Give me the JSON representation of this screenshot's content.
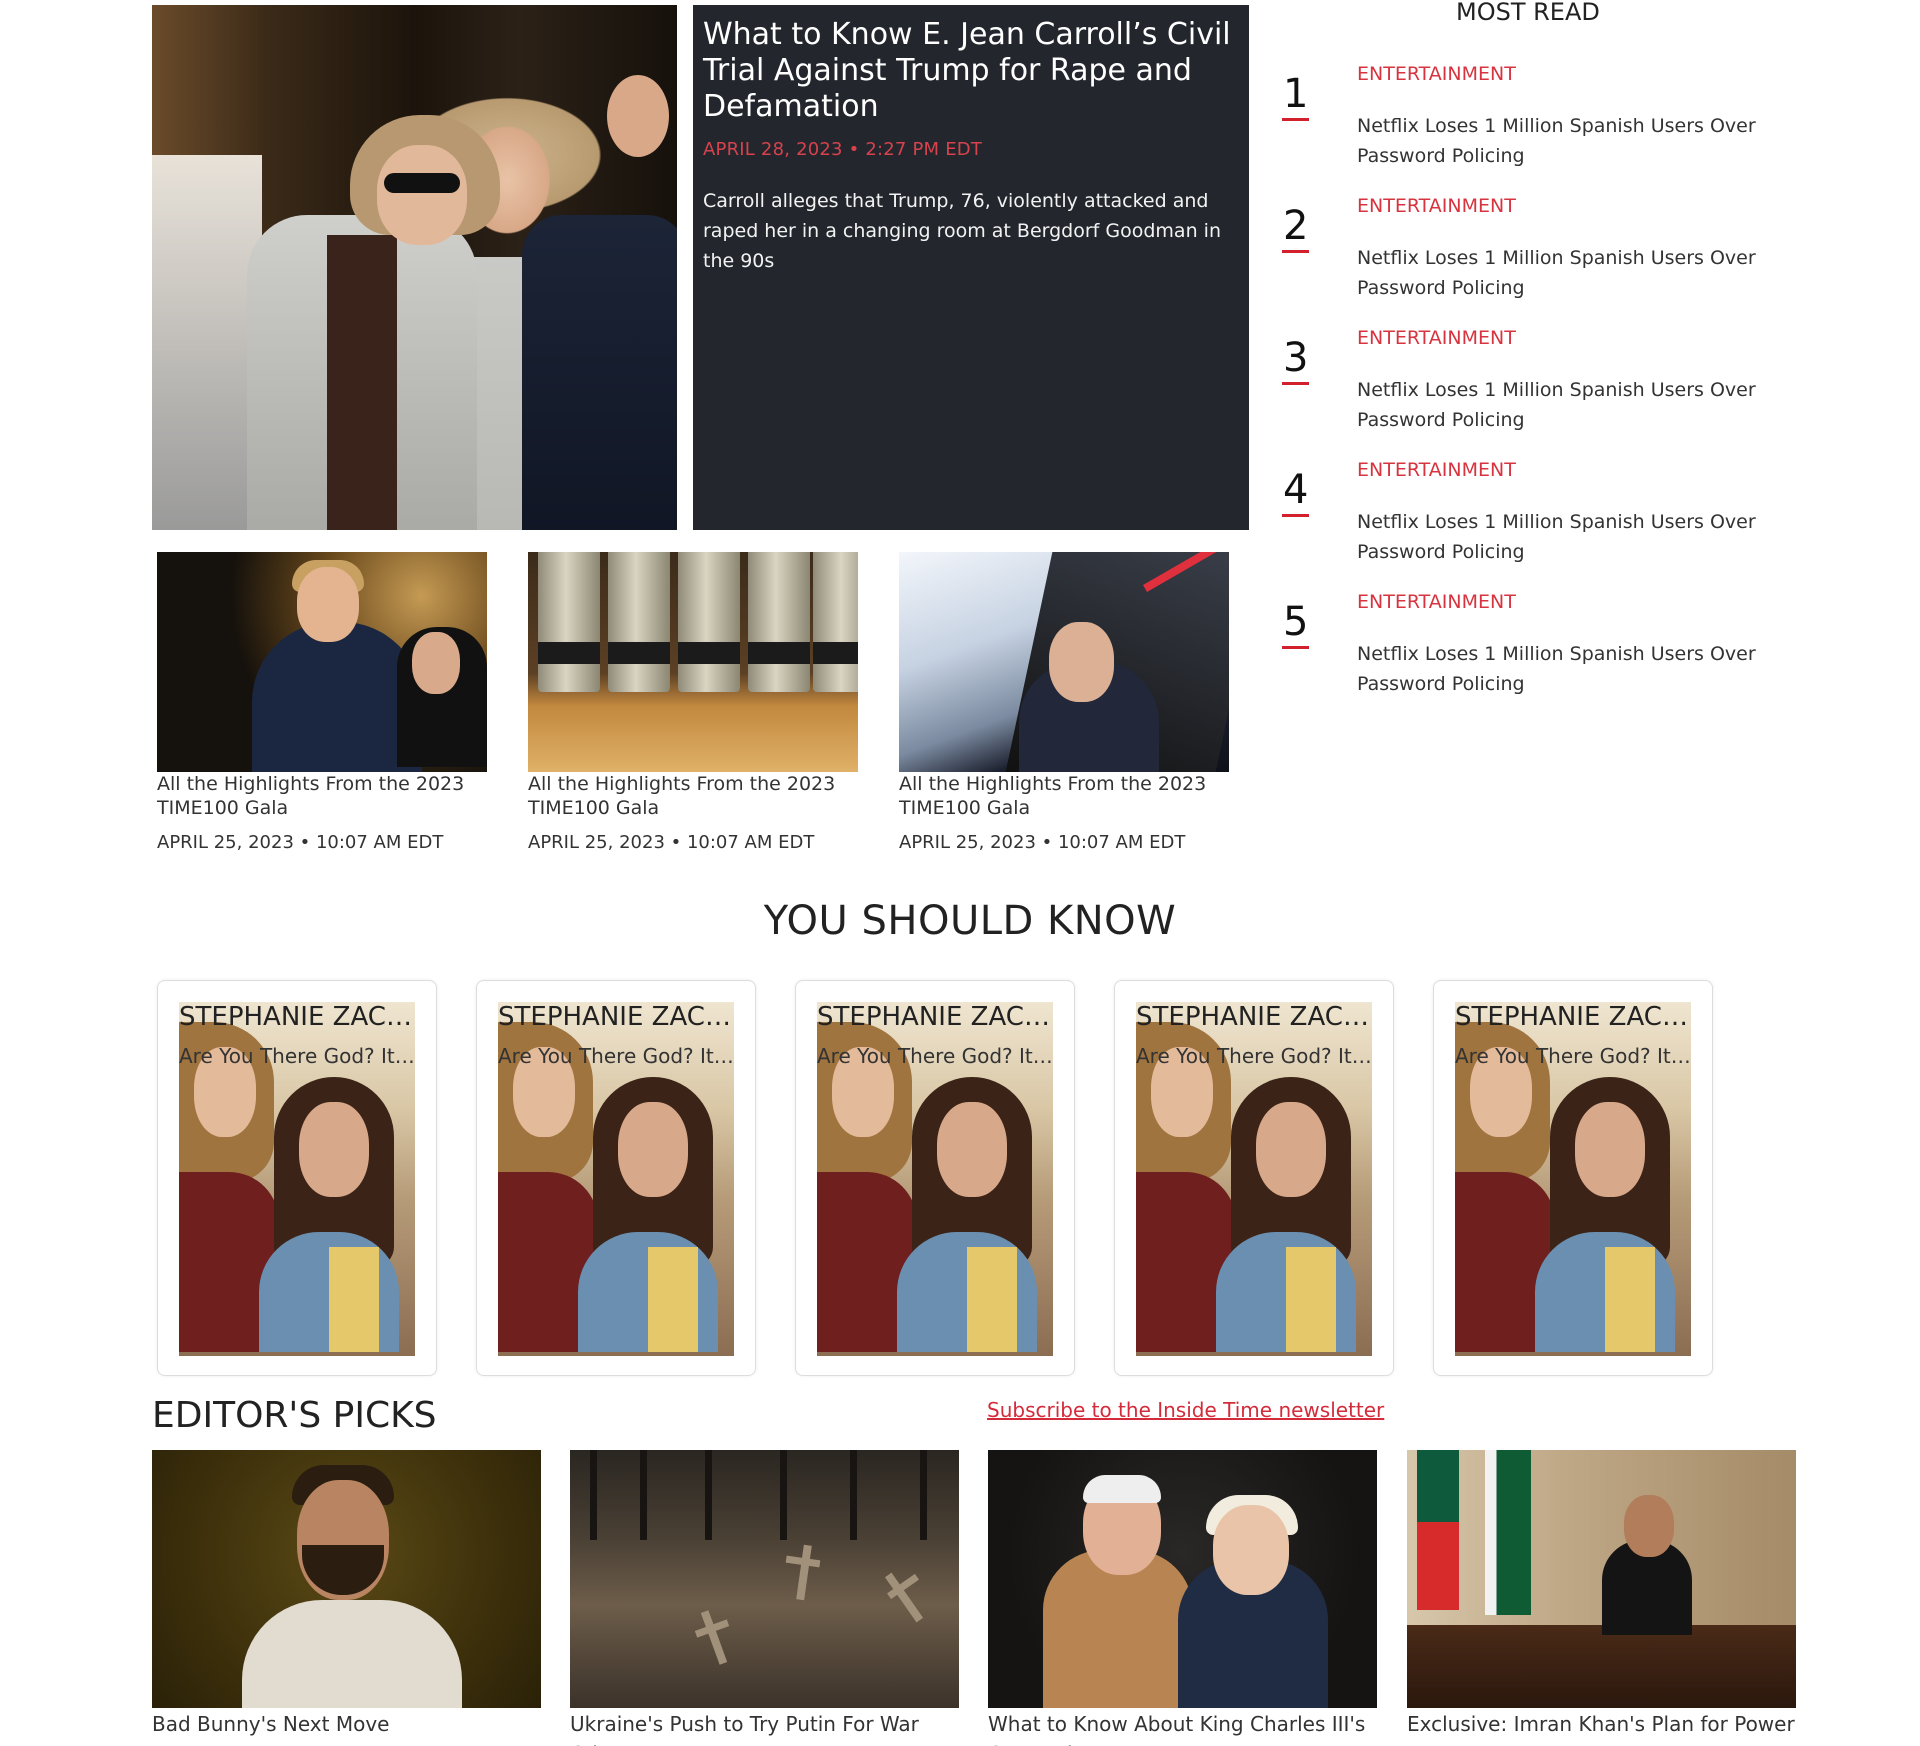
{
  "hero": {
    "title": "What to Know E. Jean Carroll’s Civil Trial Against Trump for Rape and Defamation",
    "date": "APRIL 28, 2023 • 2:27 PM EDT",
    "description": "Carroll alleges that Trump, 76, violently attacked and raped her in a changing room at Bergdorf Goodman in the 90s"
  },
  "cards": [
    {
      "title": "All the Highlights From the 2023 TIME100 Gala",
      "date": "APRIL 25, 2023 • 10:07 AM EDT"
    },
    {
      "title": "All the Highlights From the 2023 TIME100 Gala",
      "date": "APRIL 25, 2023 • 10:07 AM EDT"
    },
    {
      "title": "All the Highlights From the 2023 TIME100 Gala",
      "date": "APRIL 25, 2023 • 10:07 AM EDT"
    }
  ],
  "most_read": {
    "title": "MOST READ",
    "items": [
      {
        "num": "1",
        "category": "ENTERTAINMENT",
        "title": "Netflix Loses 1 Million Spanish Users Over Password Policing"
      },
      {
        "num": "2",
        "category": "ENTERTAINMENT",
        "title": "Netflix Loses 1 Million Spanish Users Over Password Policing"
      },
      {
        "num": "3",
        "category": "ENTERTAINMENT",
        "title": "Netflix Loses 1 Million Spanish Users Over Password Policing"
      },
      {
        "num": "4",
        "category": "ENTERTAINMENT",
        "title": "Netflix Loses 1 Million Spanish Users Over Password Policing"
      },
      {
        "num": "5",
        "category": "ENTERTAINMENT",
        "title": "Netflix Loses 1 Million Spanish Users Over Password Policing"
      }
    ]
  },
  "you_should_know": {
    "title": "YOU SHOULD KNOW",
    "items": [
      {
        "name": "STEPHANIE ZACH...",
        "subtitle": "Are You There God? It's..."
      },
      {
        "name": "STEPHANIE ZACH...",
        "subtitle": "Are You There God? It's..."
      },
      {
        "name": "STEPHANIE ZACH...",
        "subtitle": "Are You There God? It's..."
      },
      {
        "name": "STEPHANIE ZACH...",
        "subtitle": "Are You There God? It's..."
      },
      {
        "name": "STEPHANIE ZACH...",
        "subtitle": "Are You There God? It's..."
      }
    ]
  },
  "editors_picks": {
    "title": "EDITOR'S PICKS",
    "subscribe_label": "Subscribe to the Inside Time newsletter",
    "items": [
      {
        "caption": "Bad Bunny's Next Move"
      },
      {
        "caption": "Ukraine's Push to Try Putin For War Crimes"
      },
      {
        "caption": "What to Know About King Charles III's Coronation"
      },
      {
        "caption": "Exclusive: Imran Khan's Plan for Power"
      }
    ]
  },
  "colors": {
    "accent_red": "#d73440",
    "hero_panel": "#23272d"
  }
}
